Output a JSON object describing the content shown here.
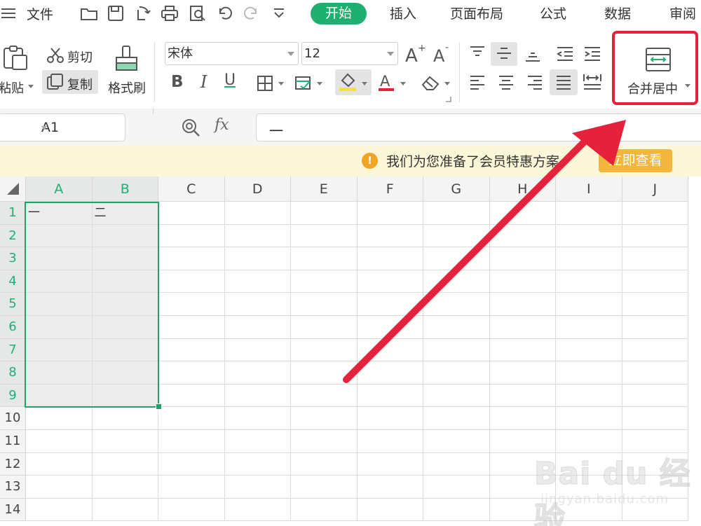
{
  "menubar": {
    "file_menu": "文件",
    "tabs": [
      {
        "label": "开始",
        "active": true
      },
      {
        "label": "插入"
      },
      {
        "label": "页面布局"
      },
      {
        "label": "公式"
      },
      {
        "label": "数据"
      },
      {
        "label": "审阅"
      }
    ]
  },
  "ribbon": {
    "paste_label": "粘贴",
    "cut_label": "剪切",
    "copy_label": "复制",
    "format_painter_label": "格式刷",
    "font_name": "宋体",
    "font_size": "12",
    "bold": "B",
    "italic": "I",
    "underline": "U",
    "merge_center_label": "合并居中",
    "accent_color": "#1fb071",
    "highlight_color": "#e5213b"
  },
  "formula_bar": {
    "cell_ref": "A1",
    "fx_label": "fx",
    "formula_value": "一"
  },
  "notice": {
    "text": "我们为您准备了会员特惠方案",
    "button": "立即查看"
  },
  "sheet": {
    "columns": [
      "A",
      "B",
      "C",
      "D",
      "E",
      "F",
      "G",
      "H",
      "I",
      "J"
    ],
    "rows": [
      "1",
      "2",
      "3",
      "4",
      "5",
      "6",
      "7",
      "8",
      "9",
      "10",
      "11",
      "12",
      "13",
      "14"
    ],
    "cells": {
      "A1": "一",
      "B1": "二"
    },
    "selected_range": "A1:B9"
  },
  "watermark": {
    "logo": "Bai du 经验",
    "url": "jingyan.baidu.com"
  }
}
